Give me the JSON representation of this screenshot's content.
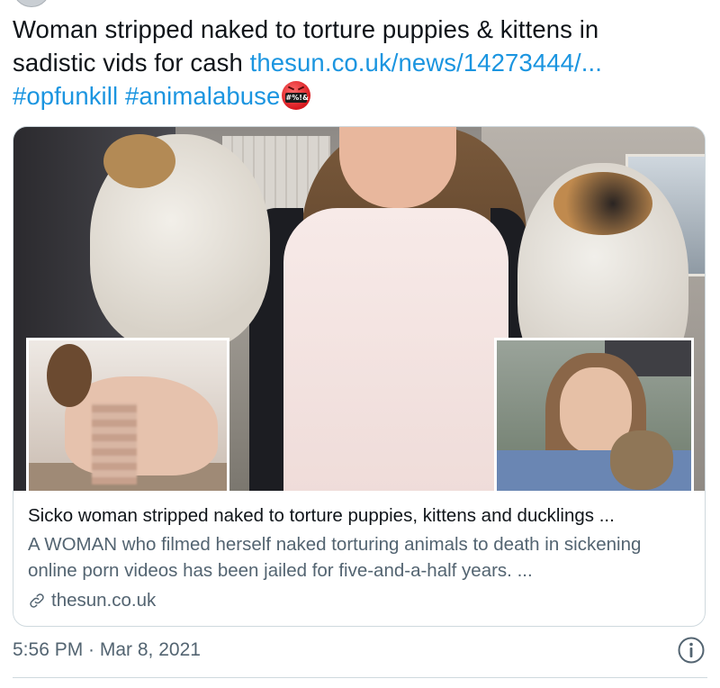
{
  "tweet": {
    "text_line1": "Woman stripped naked to torture puppies & kittens in",
    "text_line2_plain": "sadistic vids for cash ",
    "link": "thesun.co.uk/news/14273444/...",
    "hashtag1": "#opfunkill",
    "hashtag2": "#animalabuse",
    "emoji": "face-with-symbols-on-mouth",
    "emoji_symbols": "#%!&",
    "timestamp": "5:56 PM · Mar 8, 2021"
  },
  "card": {
    "title": "Sicko woman stripped naked to torture puppies, kittens and ducklings ...",
    "description": "A WOMAN who filmed herself naked torturing animals to death in sickening online porn videos has been jailed for five-and-a-half years. ...",
    "domain": "thesun.co.uk",
    "domain_icon": "link-icon"
  },
  "icons": {
    "info": "info-icon"
  },
  "colors": {
    "link": "#1b95e0",
    "secondary_text": "#536471",
    "border": "#cfd9de"
  }
}
